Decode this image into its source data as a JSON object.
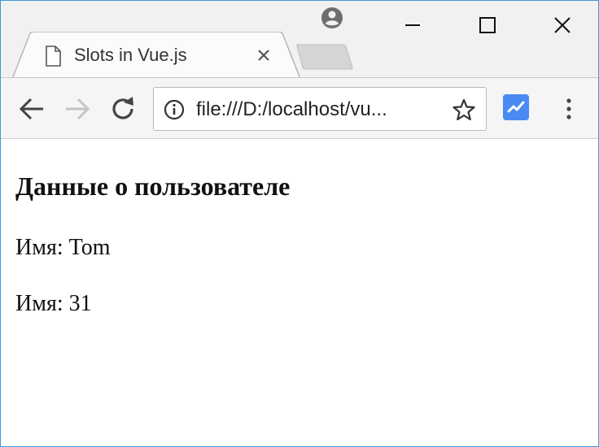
{
  "browser": {
    "tab": {
      "title": "Slots in Vue.js",
      "favicon": "page-icon"
    },
    "window_controls": [
      "minimize-icon",
      "maximize-icon",
      "close-icon"
    ],
    "toolbar": {
      "url": "file:///D:/localhost/vu..."
    },
    "colors": {
      "window_border": "#3b9ad9",
      "extension_blue": "#4a8af4",
      "tab_background": "#fbfbfb",
      "toolbar_background": "#f5f5f5"
    }
  },
  "page": {
    "heading": "Данные о пользователе",
    "lines": [
      "Имя: Tom",
      "Имя: 31"
    ]
  }
}
